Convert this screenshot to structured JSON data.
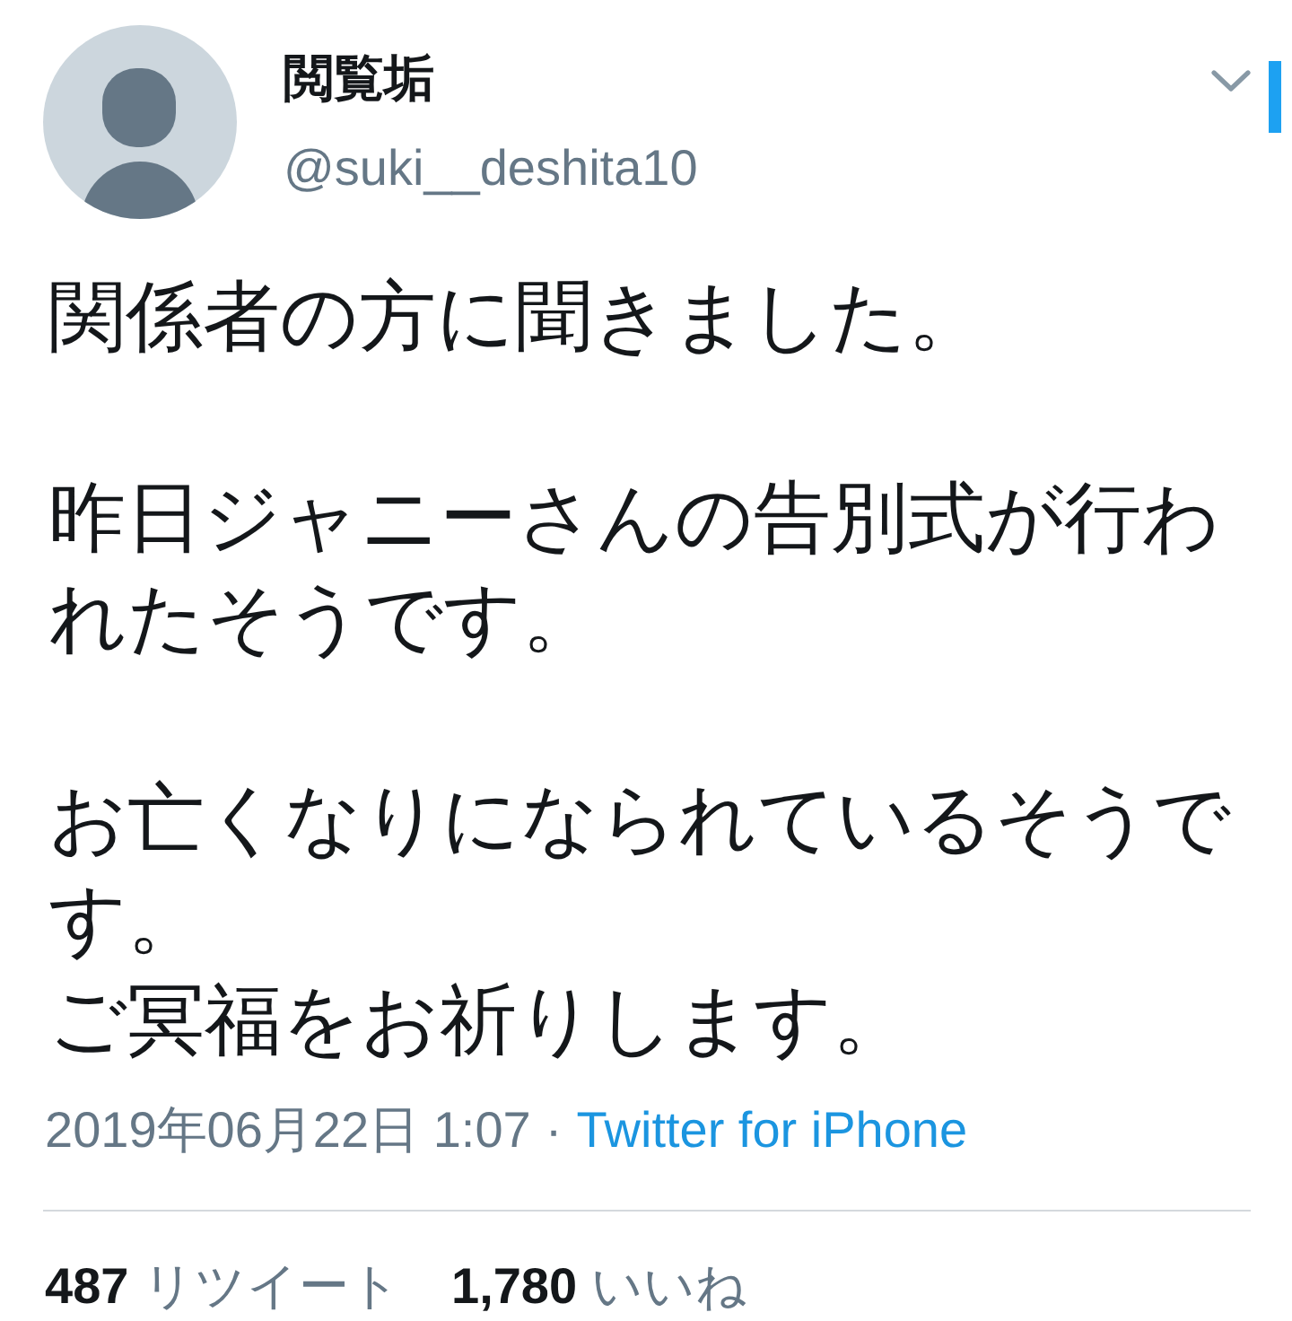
{
  "tweet": {
    "author": {
      "name": "閲覧垢",
      "handle": "@suki__deshita10"
    },
    "paragraphs": [
      [
        "関係者の方に聞きました。"
      ],
      [
        "昨日ジャニーさんの告別式が行われたそうです。"
      ],
      [
        "お亡くなりになられているそうです。",
        "ご冥福をお祈りします。"
      ]
    ],
    "timestamp": "2019年06月22日 1:07",
    "separator": "·",
    "source": "Twitter for iPhone",
    "stats": [
      {
        "count": "487",
        "label": "リツイート"
      },
      {
        "count": "1,780",
        "label": "いいね"
      }
    ]
  }
}
